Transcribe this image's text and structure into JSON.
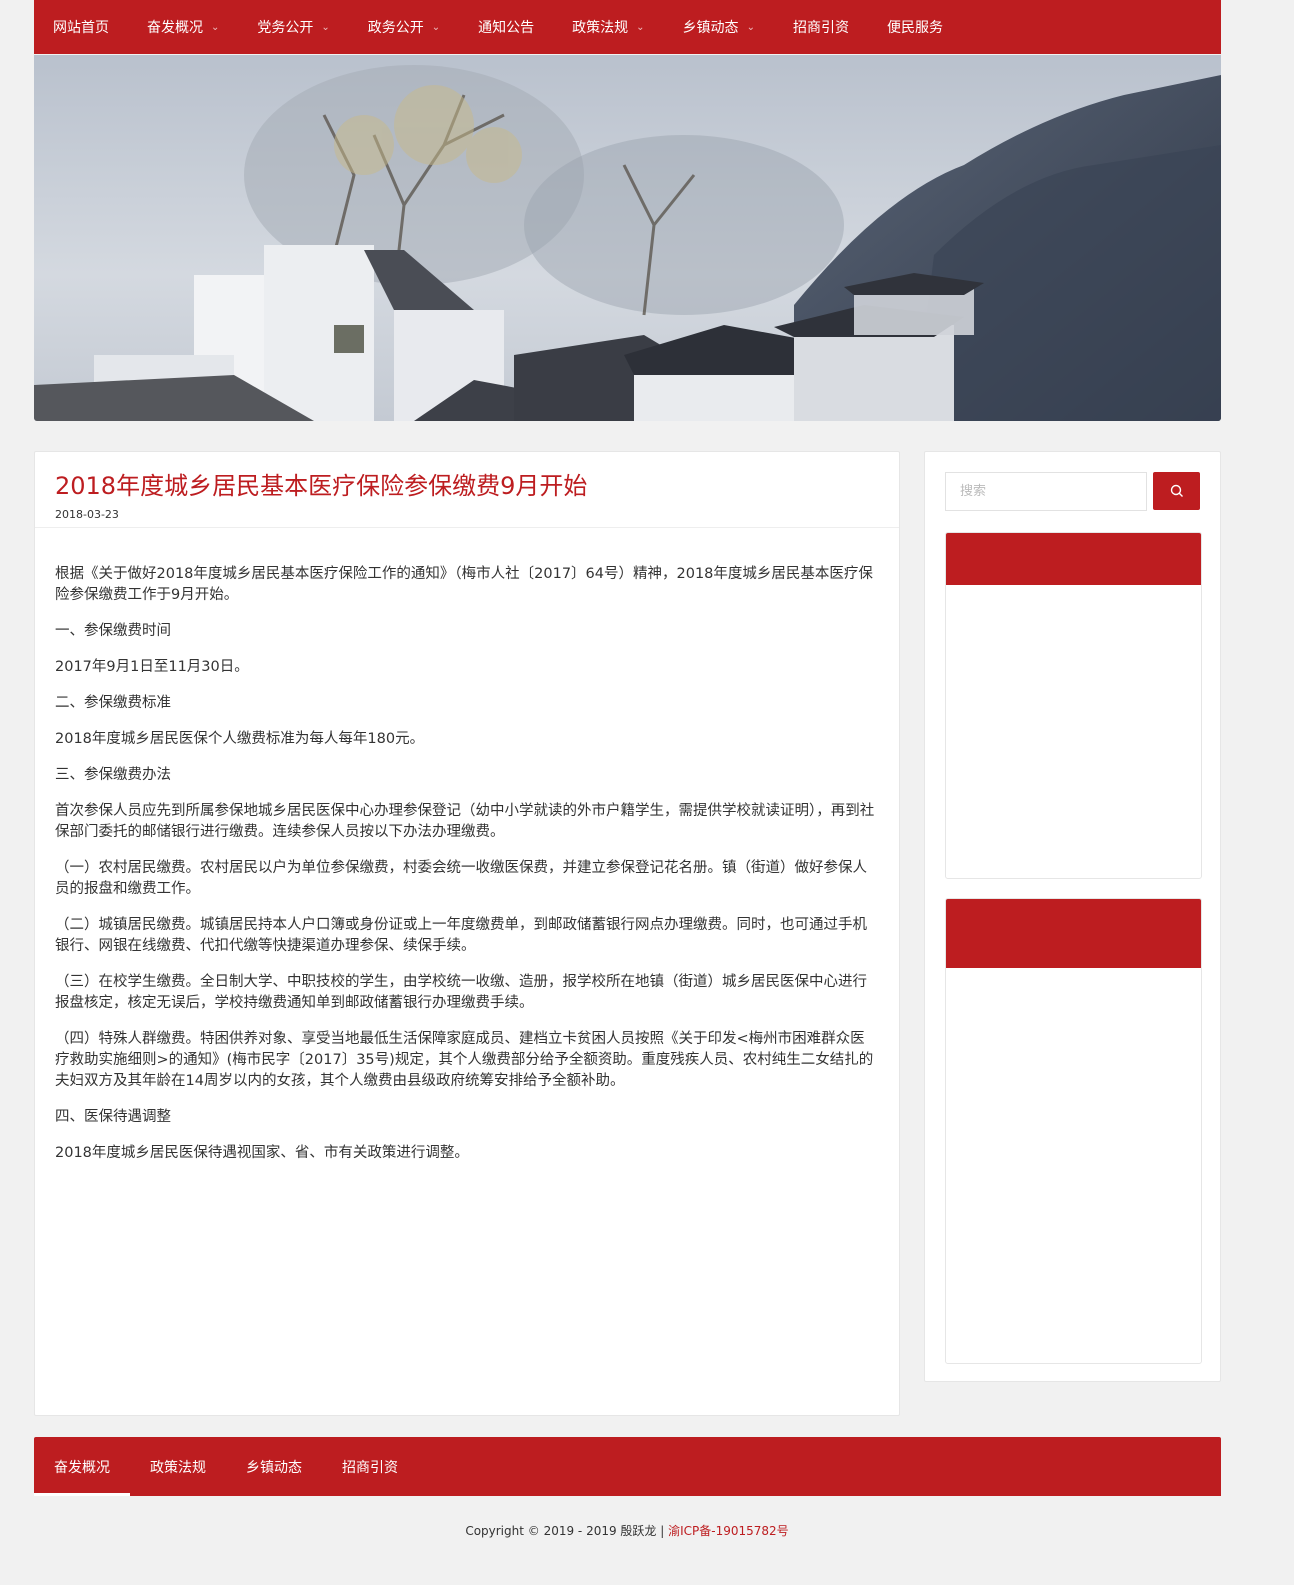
{
  "colors": {
    "brand": "#bd1d20"
  },
  "nav": {
    "items": [
      {
        "label": "网站首页",
        "has_dropdown": false
      },
      {
        "label": "奋发概况",
        "has_dropdown": true
      },
      {
        "label": "党务公开",
        "has_dropdown": true
      },
      {
        "label": "政务公开",
        "has_dropdown": true
      },
      {
        "label": "通知公告",
        "has_dropdown": false
      },
      {
        "label": "政策法规",
        "has_dropdown": true
      },
      {
        "label": "乡镇动态",
        "has_dropdown": true
      },
      {
        "label": "招商引资",
        "has_dropdown": false
      },
      {
        "label": "便民服务",
        "has_dropdown": false
      }
    ]
  },
  "article": {
    "title": "2018年度城乡居民基本医疗保险参保缴费9月开始",
    "date": "2018-03-23",
    "paragraphs": [
      "根据《关于做好2018年度城乡居民基本医疗保险工作的通知》（梅市人社〔2017〕64号）精神，2018年度城乡居民基本医疗保险参保缴费工作于9月开始。",
      "一、参保缴费时间",
      "2017年9月1日至11月30日。",
      "二、参保缴费标准",
      "2018年度城乡居民医保个人缴费标准为每人每年180元。",
      "三、参保缴费办法",
      "首次参保人员应先到所属参保地城乡居民医保中心办理参保登记（幼中小学就读的外市户籍学生，需提供学校就读证明），再到社保部门委托的邮储银行进行缴费。连续参保人员按以下办法办理缴费。",
      "（一）农村居民缴费。农村居民以户为单位参保缴费，村委会统一收缴医保费，并建立参保登记花名册。镇（街道）做好参保人员的报盘和缴费工作。",
      "（二）城镇居民缴费。城镇居民持本人户口簿或身份证或上一年度缴费单，到邮政储蓄银行网点办理缴费。同时，也可通过手机银行、网银在线缴费、代扣代缴等快捷渠道办理参保、续保手续。",
      "（三）在校学生缴费。全日制大学、中职技校的学生，由学校统一收缴、造册，报学校所在地镇（街道）城乡居民医保中心进行报盘核定，核定无误后，学校持缴费通知单到邮政储蓄银行办理缴费手续。",
      "（四）特殊人群缴费。特困供养对象、享受当地最低生活保障家庭成员、建档立卡贫困人员按照《关于印发<梅州市困难群众医疗救助实施细则>的通知》(梅市民字〔2017〕35号)规定，其个人缴费部分给予全额资助。重度残疾人员、农村纯生二女结扎的夫妇双方及其年龄在14周岁以内的女孩，其个人缴费由县级政府统筹安排给予全额补助。",
      "四、医保待遇调整",
      "2018年度城乡居民医保待遇视国家、省、市有关政策进行调整。"
    ]
  },
  "sidebar": {
    "search_placeholder": "搜索"
  },
  "bottom_nav": {
    "items": [
      {
        "label": "奋发概况",
        "active": true
      },
      {
        "label": "政策法规",
        "active": false
      },
      {
        "label": "乡镇动态",
        "active": false
      },
      {
        "label": "招商引资",
        "active": false
      }
    ]
  },
  "footer": {
    "copyright": "Copyright © 2019 - 2019 殷跃龙 | ",
    "icp": "渝ICP备-19015782号"
  }
}
